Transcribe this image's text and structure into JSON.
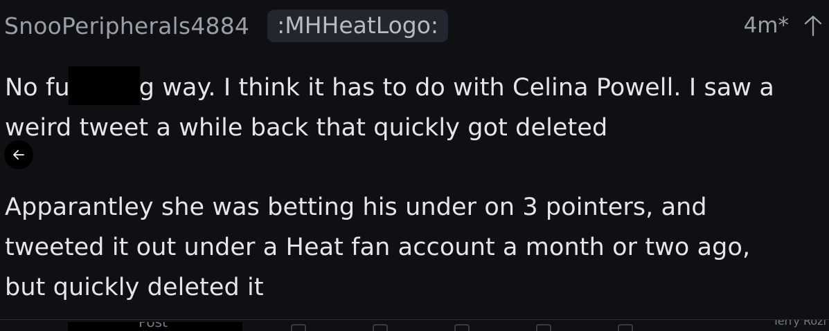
{
  "comment": {
    "author": "SnooPeripherals4884",
    "flair": ":MHHeatLogo:",
    "time": "4m*",
    "paragraph1": {
      "before_redaction": "No fu",
      "after_redaction": "g way. I think it has to do with Celina Powell. I saw a",
      "line2": "weird tweet a while back that quickly got deleted"
    },
    "paragraph2": {
      "line1": "Apparantley she was betting his under on 3 pointers, and",
      "line2": "tweeted it out under a Heat fan account a month or two ago,",
      "line3": "but quickly deleted it"
    }
  },
  "bottom_bar": {
    "tab_label": "Post",
    "right_text": "Terry Rozi"
  },
  "icons": {
    "upvote": "arrow-up-icon",
    "back": "arrow-left-icon"
  },
  "colors": {
    "background": "#0f1013",
    "username": "#9b9ea6",
    "flair_bg": "#23262f",
    "text": "#e6e6e8",
    "redaction": "#000000"
  }
}
